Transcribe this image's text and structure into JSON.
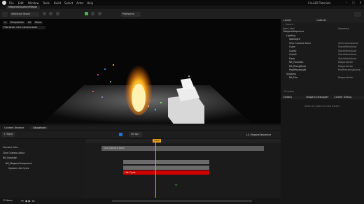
{
  "titlebar": {
    "menus": [
      "File",
      "Edit",
      "Window",
      "Tools",
      "Build",
      "Select",
      "Actor",
      "Help"
    ],
    "project": "Cine3D Tutorials",
    "tab": "MagaraSequenceMagai"
  },
  "toolbar": {
    "mode": "Selection Mode",
    "platforms": "Platforms"
  },
  "viewport": {
    "perspective": "Perspective",
    "lit": "Lit",
    "show": "Show",
    "pilot": "Pilot Actor: Cine Camera Actor"
  },
  "outliner": {
    "title": "Levels",
    "title2": "Outliner",
    "search_placeholder": "Search...",
    "col_label": "Item Label",
    "col_type": "Sequence",
    "items": [
      {
        "label": "NiagaraSequence",
        "type": ""
      },
      {
        "label": "Lighting",
        "type": ""
      },
      {
        "label": "SpotLight",
        "type": ""
      },
      {
        "label": "Cine Camera Actor",
        "type": "CineCameraActor"
      },
      {
        "label": "Cube",
        "type": "StaticMeshActor"
      },
      {
        "label": "Cube2",
        "type": "StaticMeshActor"
      },
      {
        "label": "Cube3",
        "type": "StaticMeshActor"
      },
      {
        "label": "Floor",
        "type": "StaticMeshActor"
      },
      {
        "label": "NS_Fountain",
        "type": "NiagaraActor"
      },
      {
        "label": "NS_RisingBurb",
        "type": "NiagaraActor"
      },
      {
        "label": "PostProcessVol",
        "type": "PostProcessVolume"
      },
      {
        "label": "Systems",
        "type": ""
      },
      {
        "label": "NS_Fire",
        "type": "NiagaraActor"
      }
    ],
    "count": "13 actors"
  },
  "details": {
    "title": "Details",
    "debugger": "Niagara Debugger",
    "cluster": "Cluster Debug",
    "empty": "Select an object to view details."
  },
  "sequencer": {
    "tab1": "Content Browser",
    "tab2": "Sequencer",
    "fps": "30 fps",
    "seqname": "LS_MagaraSequence",
    "track_btn": "+ Track",
    "tracks": [
      "Camera Cuts",
      "Cine Camera Actor",
      "NS_Fountain",
      "NS_MagaraComponent",
      "System Life Cycle"
    ],
    "bar_label": "Cine Camera Actor",
    "red_label": "Life Cycle",
    "frame": "0090",
    "items_count": "13 items"
  },
  "colors": {
    "accent": "#e0e0e0",
    "red_bar": "#d00000",
    "playhead": "#e8a317",
    "blue": "#2a6fd6"
  }
}
